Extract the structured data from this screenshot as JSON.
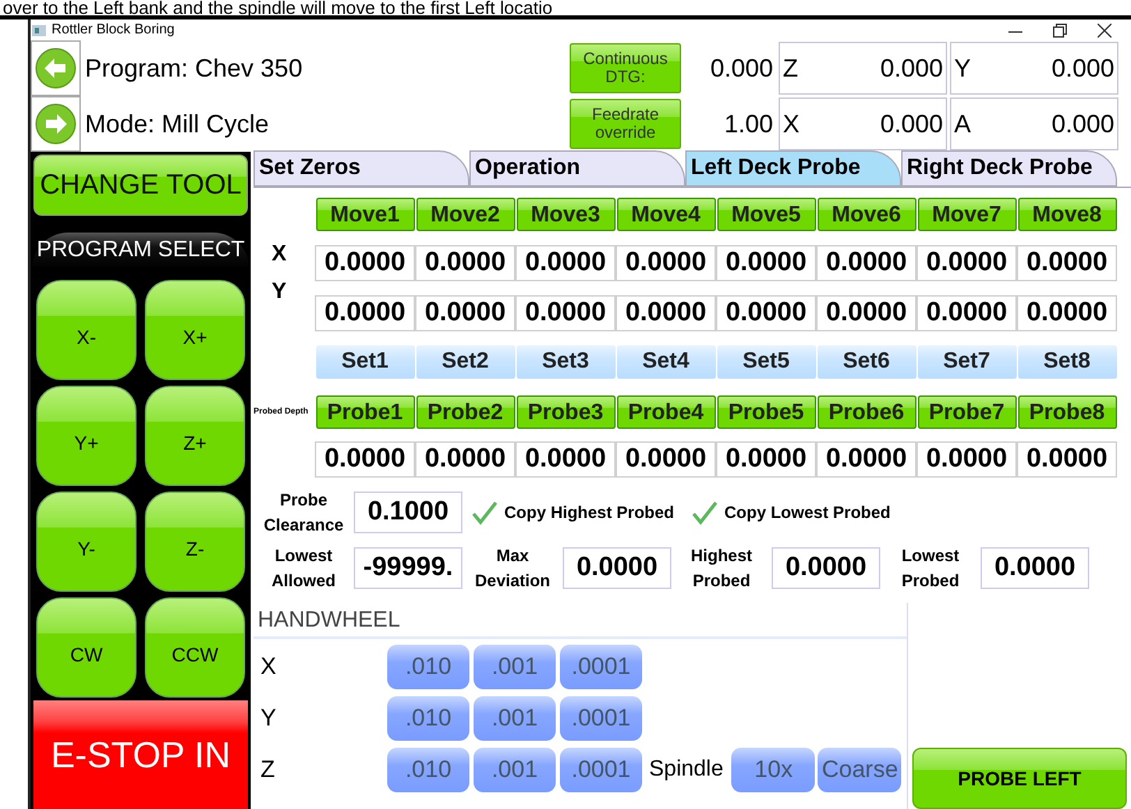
{
  "caption": "over to the Left bank and the spindle will move to the first Left locatio",
  "window": {
    "title": "Rottler Block Boring"
  },
  "header": {
    "program": "Program: Chev 350",
    "mode": "Mode: Mill Cycle",
    "dtg_button": "Continuous DTG:",
    "dtg_value": "0.000",
    "feed_button": "Feedrate override",
    "feed_value": "1.00",
    "axes": [
      {
        "label": "Z",
        "value": "0.000"
      },
      {
        "label": "Y",
        "value": "0.000"
      },
      {
        "label": "X",
        "value": "0.000"
      },
      {
        "label": "A",
        "value": "0.000"
      }
    ]
  },
  "sidebar": {
    "change_tool": "CHANGE TOOL",
    "program_select": "PROGRAM SELECT",
    "jog": [
      "X-",
      "X+",
      "Y+",
      "Z+",
      "Y-",
      "Z-",
      "CW",
      "CCW"
    ],
    "estop": "E-STOP IN"
  },
  "tabs": [
    {
      "label": "Set Zeros",
      "selected": false
    },
    {
      "label": "Operation",
      "selected": false
    },
    {
      "label": "Left Deck Probe",
      "selected": true
    },
    {
      "label": "Right Deck Probe",
      "selected": false
    }
  ],
  "probe_grid": {
    "moves": [
      "Move1",
      "Move2",
      "Move3",
      "Move4",
      "Move5",
      "Move6",
      "Move7",
      "Move8"
    ],
    "x_label": "X",
    "y_label": "Y",
    "x_values": [
      "0.0000",
      "0.0000",
      "0.0000",
      "0.0000",
      "0.0000",
      "0.0000",
      "0.0000",
      "0.0000"
    ],
    "y_values": [
      "0.0000",
      "0.0000",
      "0.0000",
      "0.0000",
      "0.0000",
      "0.0000",
      "0.0000",
      "0.0000"
    ],
    "sets": [
      "Set1",
      "Set2",
      "Set3",
      "Set4",
      "Set5",
      "Set6",
      "Set7",
      "Set8"
    ],
    "depth_label": "Probed Depth",
    "probes": [
      "Probe1",
      "Probe2",
      "Probe3",
      "Probe4",
      "Probe5",
      "Probe6",
      "Probe7",
      "Probe8"
    ],
    "depth_values": [
      "0.0000",
      "0.0000",
      "0.0000",
      "0.0000",
      "0.0000",
      "0.0000",
      "0.0000",
      "0.0000"
    ]
  },
  "clearance": {
    "label": "Probe Clearance",
    "value": "0.1000"
  },
  "checks": [
    {
      "label": "Copy Highest Probed",
      "checked": true
    },
    {
      "label": "Copy Lowest Probed",
      "checked": true
    }
  ],
  "fields": [
    {
      "label": "Lowest Allowed",
      "value": "-99999."
    },
    {
      "label": "Max Deviation",
      "value": "0.0000"
    },
    {
      "label": "Highest Probed",
      "value": "0.0000"
    },
    {
      "label": "Lowest Probed",
      "value": "0.0000"
    }
  ],
  "handwheel": {
    "title": "HANDWHEEL",
    "rows": [
      {
        "axis": "X",
        "steps": [
          ".010",
          ".001",
          ".0001"
        ]
      },
      {
        "axis": "Y",
        "steps": [
          ".010",
          ".001",
          ".0001"
        ]
      },
      {
        "axis": "Z",
        "steps": [
          ".010",
          ".001",
          ".0001"
        ]
      }
    ],
    "spindle_label": "Spindle",
    "spindle_buttons": [
      "10x",
      "Coarse"
    ]
  },
  "probe_button": "PROBE LEFT"
}
